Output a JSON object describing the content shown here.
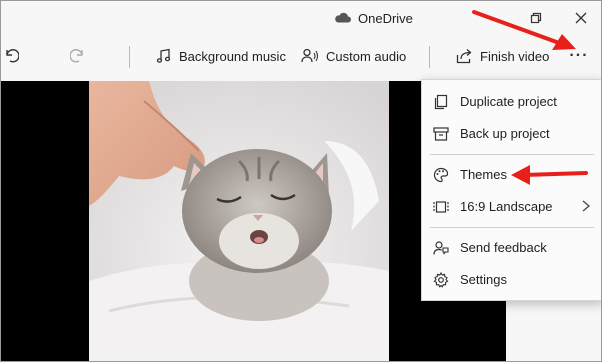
{
  "titlebar": {
    "title": "OneDrive",
    "cloud_icon": "cloud-icon",
    "restore_icon": "restore-icon",
    "close_icon": "close-icon"
  },
  "toolbar": {
    "undo_icon": "undo-icon",
    "redo_icon": "redo-icon",
    "background_music_label": "Background music",
    "custom_audio_label": "Custom audio",
    "finish_video_label": "Finish video",
    "more_label": "..."
  },
  "menu": {
    "items": [
      {
        "label": "Duplicate project",
        "icon": "duplicate-icon"
      },
      {
        "label": "Back up project",
        "icon": "archive-icon"
      },
      {
        "label": "Themes",
        "icon": "palette-icon"
      },
      {
        "label": "16:9 Landscape",
        "icon": "aspect-ratio-icon",
        "has_submenu": true
      },
      {
        "label": "Send feedback",
        "icon": "feedback-icon"
      },
      {
        "label": "Settings",
        "icon": "gear-icon"
      }
    ]
  },
  "preview": {
    "description_icon": "video-preview"
  },
  "colors": {
    "annotation_red": "#e8201a",
    "toolbar_bg": "#f7f7f7",
    "menu_bg": "#fbfbfb"
  }
}
